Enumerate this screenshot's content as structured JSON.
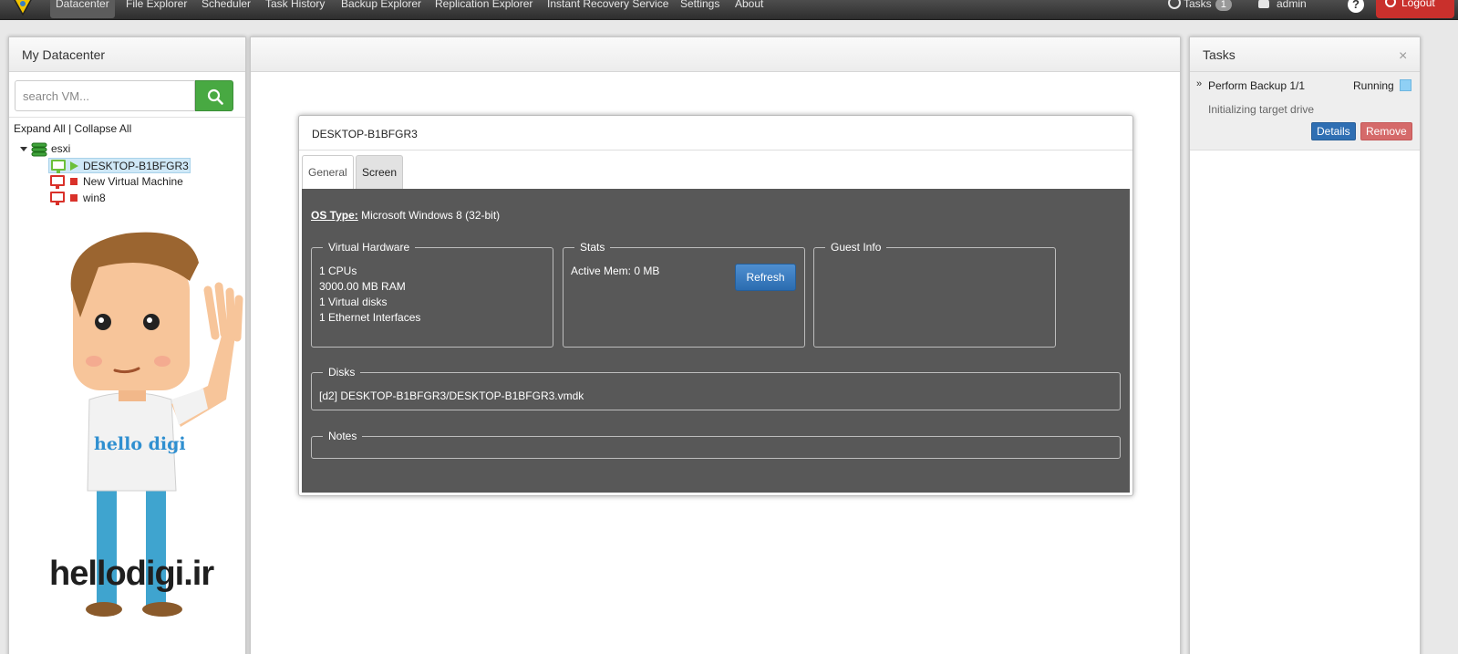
{
  "navbar": {
    "items": [
      "Datacenter",
      "File Explorer",
      "Scheduler",
      "Task History",
      "Backup Explorer",
      "Replication Explorer",
      "Instant Recovery Service",
      "Settings",
      "About"
    ],
    "active": "Datacenter",
    "tasks_label": "Tasks",
    "tasks_count": "1",
    "user": "admin",
    "help": "?",
    "logout": "Logout"
  },
  "left_panel": {
    "title": "My Datacenter",
    "search_placeholder": "search VM...",
    "expand_all": "Expand All",
    "separator": "|",
    "collapse_all": "Collapse All",
    "tree": {
      "host": "esxi",
      "vms": [
        {
          "name": "DESKTOP-B1BFGR3",
          "state": "running",
          "selected": true
        },
        {
          "name": "New Virtual Machine",
          "state": "stopped",
          "selected": false
        },
        {
          "name": "win8",
          "state": "stopped",
          "selected": false
        }
      ]
    },
    "watermark": {
      "shirt": "hello digi",
      "site": "hellodigi.ir"
    }
  },
  "vm_window": {
    "title": "DESKTOP-B1BFGR3",
    "tabs": [
      "General",
      "Screen"
    ],
    "active_tab": "General",
    "os_type_label": "OS Type:",
    "os_type_value": "Microsoft Windows 8 (32-bit)",
    "virtual_hardware": {
      "legend": "Virtual Hardware",
      "lines": [
        "1 CPUs",
        "3000.00 MB RAM",
        "1 Virtual disks",
        "1 Ethernet Interfaces"
      ]
    },
    "stats": {
      "legend": "Stats",
      "active_mem": "Active Mem: 0 MB",
      "refresh": "Refresh"
    },
    "guest_info": {
      "legend": "Guest Info"
    },
    "disks": {
      "legend": "Disks",
      "entries": [
        "[d2] DESKTOP-B1BFGR3/DESKTOP-B1BFGR3.vmdk"
      ]
    },
    "notes": {
      "legend": "Notes"
    }
  },
  "tasks_panel": {
    "title": "Tasks",
    "close": "×",
    "task": {
      "name": "Perform Backup 1/1",
      "status": "Running",
      "detail": "Initializing target drive",
      "details_button": "Details",
      "remove_button": "Remove"
    }
  },
  "colors": {
    "nav_bg": "#3a3a3a",
    "search_button": "#48a942",
    "vm_body": "#585858",
    "refresh_button": "#2b6cb0",
    "logout": "#c9302c",
    "status_running": "#8fd0f5"
  }
}
